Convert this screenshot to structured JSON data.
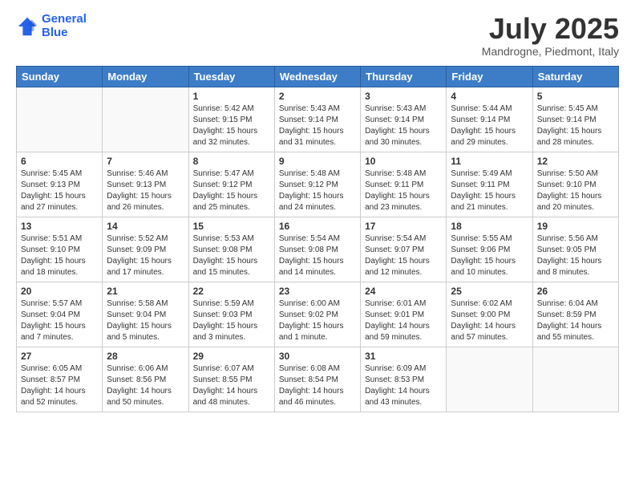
{
  "logo": {
    "line1": "General",
    "line2": "Blue"
  },
  "title": "July 2025",
  "subtitle": "Mandrogne, Piedmont, Italy",
  "weekdays": [
    "Sunday",
    "Monday",
    "Tuesday",
    "Wednesday",
    "Thursday",
    "Friday",
    "Saturday"
  ],
  "weeks": [
    [
      {
        "day": "",
        "sunrise": "",
        "sunset": "",
        "daylight": ""
      },
      {
        "day": "",
        "sunrise": "",
        "sunset": "",
        "daylight": ""
      },
      {
        "day": "1",
        "sunrise": "Sunrise: 5:42 AM",
        "sunset": "Sunset: 9:15 PM",
        "daylight": "Daylight: 15 hours and 32 minutes."
      },
      {
        "day": "2",
        "sunrise": "Sunrise: 5:43 AM",
        "sunset": "Sunset: 9:14 PM",
        "daylight": "Daylight: 15 hours and 31 minutes."
      },
      {
        "day": "3",
        "sunrise": "Sunrise: 5:43 AM",
        "sunset": "Sunset: 9:14 PM",
        "daylight": "Daylight: 15 hours and 30 minutes."
      },
      {
        "day": "4",
        "sunrise": "Sunrise: 5:44 AM",
        "sunset": "Sunset: 9:14 PM",
        "daylight": "Daylight: 15 hours and 29 minutes."
      },
      {
        "day": "5",
        "sunrise": "Sunrise: 5:45 AM",
        "sunset": "Sunset: 9:14 PM",
        "daylight": "Daylight: 15 hours and 28 minutes."
      }
    ],
    [
      {
        "day": "6",
        "sunrise": "Sunrise: 5:45 AM",
        "sunset": "Sunset: 9:13 PM",
        "daylight": "Daylight: 15 hours and 27 minutes."
      },
      {
        "day": "7",
        "sunrise": "Sunrise: 5:46 AM",
        "sunset": "Sunset: 9:13 PM",
        "daylight": "Daylight: 15 hours and 26 minutes."
      },
      {
        "day": "8",
        "sunrise": "Sunrise: 5:47 AM",
        "sunset": "Sunset: 9:12 PM",
        "daylight": "Daylight: 15 hours and 25 minutes."
      },
      {
        "day": "9",
        "sunrise": "Sunrise: 5:48 AM",
        "sunset": "Sunset: 9:12 PM",
        "daylight": "Daylight: 15 hours and 24 minutes."
      },
      {
        "day": "10",
        "sunrise": "Sunrise: 5:48 AM",
        "sunset": "Sunset: 9:11 PM",
        "daylight": "Daylight: 15 hours and 23 minutes."
      },
      {
        "day": "11",
        "sunrise": "Sunrise: 5:49 AM",
        "sunset": "Sunset: 9:11 PM",
        "daylight": "Daylight: 15 hours and 21 minutes."
      },
      {
        "day": "12",
        "sunrise": "Sunrise: 5:50 AM",
        "sunset": "Sunset: 9:10 PM",
        "daylight": "Daylight: 15 hours and 20 minutes."
      }
    ],
    [
      {
        "day": "13",
        "sunrise": "Sunrise: 5:51 AM",
        "sunset": "Sunset: 9:10 PM",
        "daylight": "Daylight: 15 hours and 18 minutes."
      },
      {
        "day": "14",
        "sunrise": "Sunrise: 5:52 AM",
        "sunset": "Sunset: 9:09 PM",
        "daylight": "Daylight: 15 hours and 17 minutes."
      },
      {
        "day": "15",
        "sunrise": "Sunrise: 5:53 AM",
        "sunset": "Sunset: 9:08 PM",
        "daylight": "Daylight: 15 hours and 15 minutes."
      },
      {
        "day": "16",
        "sunrise": "Sunrise: 5:54 AM",
        "sunset": "Sunset: 9:08 PM",
        "daylight": "Daylight: 15 hours and 14 minutes."
      },
      {
        "day": "17",
        "sunrise": "Sunrise: 5:54 AM",
        "sunset": "Sunset: 9:07 PM",
        "daylight": "Daylight: 15 hours and 12 minutes."
      },
      {
        "day": "18",
        "sunrise": "Sunrise: 5:55 AM",
        "sunset": "Sunset: 9:06 PM",
        "daylight": "Daylight: 15 hours and 10 minutes."
      },
      {
        "day": "19",
        "sunrise": "Sunrise: 5:56 AM",
        "sunset": "Sunset: 9:05 PM",
        "daylight": "Daylight: 15 hours and 8 minutes."
      }
    ],
    [
      {
        "day": "20",
        "sunrise": "Sunrise: 5:57 AM",
        "sunset": "Sunset: 9:04 PM",
        "daylight": "Daylight: 15 hours and 7 minutes."
      },
      {
        "day": "21",
        "sunrise": "Sunrise: 5:58 AM",
        "sunset": "Sunset: 9:04 PM",
        "daylight": "Daylight: 15 hours and 5 minutes."
      },
      {
        "day": "22",
        "sunrise": "Sunrise: 5:59 AM",
        "sunset": "Sunset: 9:03 PM",
        "daylight": "Daylight: 15 hours and 3 minutes."
      },
      {
        "day": "23",
        "sunrise": "Sunrise: 6:00 AM",
        "sunset": "Sunset: 9:02 PM",
        "daylight": "Daylight: 15 hours and 1 minute."
      },
      {
        "day": "24",
        "sunrise": "Sunrise: 6:01 AM",
        "sunset": "Sunset: 9:01 PM",
        "daylight": "Daylight: 14 hours and 59 minutes."
      },
      {
        "day": "25",
        "sunrise": "Sunrise: 6:02 AM",
        "sunset": "Sunset: 9:00 PM",
        "daylight": "Daylight: 14 hours and 57 minutes."
      },
      {
        "day": "26",
        "sunrise": "Sunrise: 6:04 AM",
        "sunset": "Sunset: 8:59 PM",
        "daylight": "Daylight: 14 hours and 55 minutes."
      }
    ],
    [
      {
        "day": "27",
        "sunrise": "Sunrise: 6:05 AM",
        "sunset": "Sunset: 8:57 PM",
        "daylight": "Daylight: 14 hours and 52 minutes."
      },
      {
        "day": "28",
        "sunrise": "Sunrise: 6:06 AM",
        "sunset": "Sunset: 8:56 PM",
        "daylight": "Daylight: 14 hours and 50 minutes."
      },
      {
        "day": "29",
        "sunrise": "Sunrise: 6:07 AM",
        "sunset": "Sunset: 8:55 PM",
        "daylight": "Daylight: 14 hours and 48 minutes."
      },
      {
        "day": "30",
        "sunrise": "Sunrise: 6:08 AM",
        "sunset": "Sunset: 8:54 PM",
        "daylight": "Daylight: 14 hours and 46 minutes."
      },
      {
        "day": "31",
        "sunrise": "Sunrise: 6:09 AM",
        "sunset": "Sunset: 8:53 PM",
        "daylight": "Daylight: 14 hours and 43 minutes."
      },
      {
        "day": "",
        "sunrise": "",
        "sunset": "",
        "daylight": ""
      },
      {
        "day": "",
        "sunrise": "",
        "sunset": "",
        "daylight": ""
      }
    ]
  ]
}
